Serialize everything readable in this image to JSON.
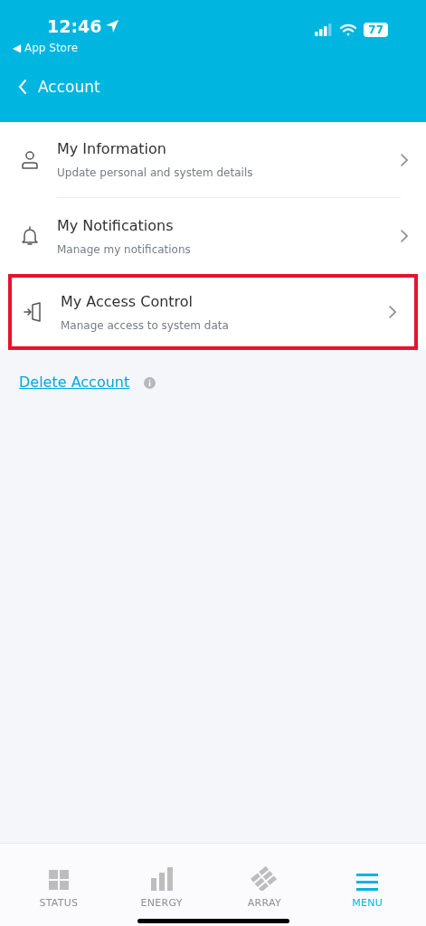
{
  "status_bar": {
    "time": "12:46",
    "back_app": "◀ App Store",
    "battery": "77"
  },
  "header": {
    "title": "Account"
  },
  "items": [
    {
      "kind": "person",
      "title": "My Information",
      "subtitle": "Update personal and system details",
      "highlighted": false
    },
    {
      "kind": "bell",
      "title": "My Notifications",
      "subtitle": "Manage my notifications",
      "highlighted": false
    },
    {
      "kind": "door",
      "title": "My Access Control",
      "subtitle": "Manage access to system data",
      "highlighted": true
    }
  ],
  "delete_link": "Delete Account",
  "tabs": [
    {
      "kind": "status",
      "label": "STATUS",
      "selected": false
    },
    {
      "kind": "energy",
      "label": "ENERGY",
      "selected": false
    },
    {
      "kind": "array",
      "label": "ARRAY",
      "selected": false
    },
    {
      "kind": "menu",
      "label": "MENU",
      "selected": true
    }
  ]
}
